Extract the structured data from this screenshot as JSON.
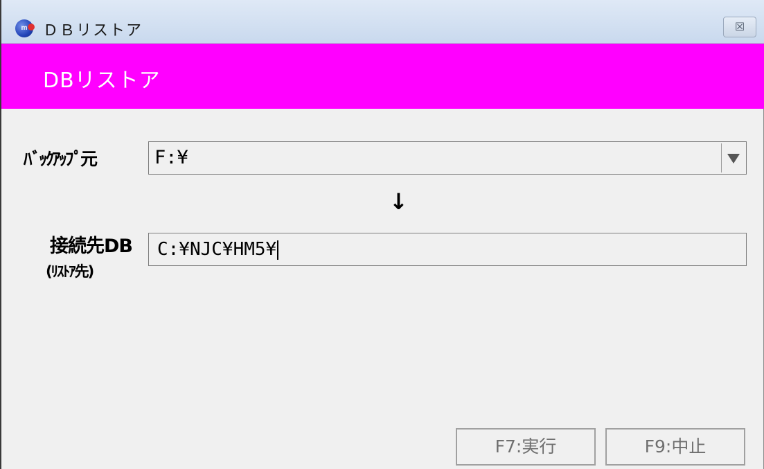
{
  "window": {
    "title": "ＤＢリストア",
    "icon_name": "app-icon",
    "close_symbol": "☒"
  },
  "header": {
    "title": "DBリストア",
    "background_color": "#ff00ff"
  },
  "form": {
    "source_label": "ﾊﾞｯｸｱｯﾌﾟ元",
    "source_value": "F:¥",
    "arrow_symbol": "↓",
    "dest_label": "接続先DB",
    "dest_sublabel": "(ﾘｽﾄｱ先)",
    "dest_value": "C:¥NJC¥HM5¥"
  },
  "buttons": {
    "execute_label": "F7:実行",
    "cancel_label": "F9:中止"
  }
}
